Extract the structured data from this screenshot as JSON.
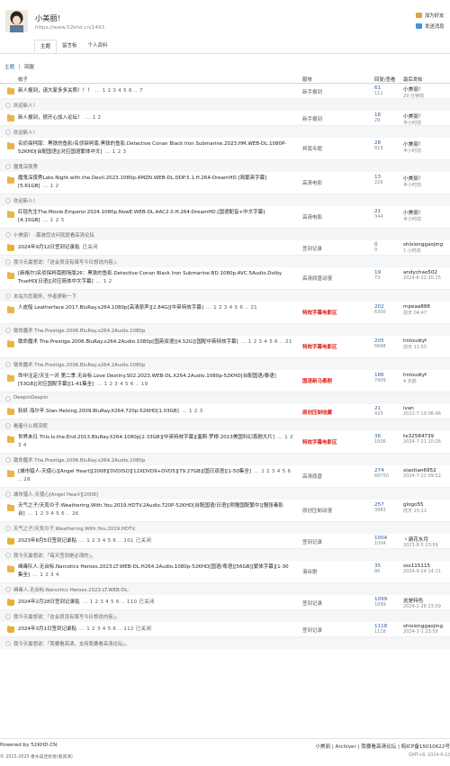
{
  "site": {
    "name": "小美丽！",
    "url": "https://www.52khd.cn/1493"
  },
  "header_actions": [
    {
      "label": "加为好友",
      "color": "#e0a23a"
    },
    {
      "label": "发送消息",
      "color": "#4a8fd6"
    }
  ],
  "tabs": [
    {
      "label": "主题",
      "active": true
    },
    {
      "label": "留言板",
      "active": false
    },
    {
      "label": "个人资料",
      "active": false
    }
  ],
  "breadcrumb": {
    "first": "主题",
    "second": "回复"
  },
  "table_header": {
    "title": "帖子",
    "forum": "版块",
    "replies": "回复/查看",
    "last": "最后发帖"
  },
  "rows": [
    {
      "title": "新人报到，请大家多多关照！！！",
      "pages": "... 1 2 3 4 5 6 .. 7",
      "forum": "新手报到",
      "forum_red": false,
      "replies": "61",
      "views": "111",
      "last_user": "小美丽！",
      "last_time": "29 分钟前",
      "sub": "欢迎新人！",
      "lines": 1,
      "icon": "folder"
    },
    {
      "title": "新人报到，很开心加入论坛！",
      "pages": "... 1 2",
      "forum": "新手报到",
      "forum_red": false,
      "replies": "18",
      "views": "29",
      "last_user": "小美丽！",
      "last_time": "半小时前",
      "sub": "欢迎新人！",
      "lines": 1,
      "icon": "folder"
    },
    {
      "title": "名侦探柯南：黑铁的鱼影/名侦探柯南.黑铁的鱼影.Detective Conan Black Iron Submarine.2023.HM.WEB-DL.1080P-52KHD[台配国语][对应国语繁体中文]",
      "pages": "... 1 2 3",
      "forum": "柯南专题",
      "forum_red": false,
      "replies": "28",
      "views": "819",
      "last_user": "小美丽！",
      "last_time": "半小时前",
      "sub": "魔鬼深夜秀",
      "lines": 2,
      "icon": "folder"
    },
    {
      "title": "魔鬼深夜秀Late.Night.with.the.Devil.2023.1080p.AMZN.WEB-DL.DDP.5.1.H.264-DreamHD.[简繁英字幕][5.61GB]",
      "pages": "... 1 2",
      "forum": "高清电影",
      "forum_red": false,
      "replies": "13",
      "views": "226",
      "last_user": "小美丽！",
      "last_time": "半小时前",
      "sub": "欢迎新人！",
      "lines": 2,
      "icon": "folder"
    },
    {
      "title": "红毯先生The.Movie.Emperor.2024.1080p.NowE.WEB-DL.AAC2.0.H.264-DreamHD.[国语配音+中文字幕][4.15GB]",
      "pages": "... 1 2 3",
      "forum": "高清电影",
      "forum_red": false,
      "replies": "21",
      "views": "344",
      "last_user": "小美丽！",
      "last_time": "半小时前",
      "sub": "小美丽！  :慕游您访问就提看高清论坛",
      "lines": 2,
      "icon": "folder"
    },
    {
      "title": "2024年9月12日签到记录贴",
      "pages": "已关闭",
      "forum": "签到记录",
      "forum_red": false,
      "replies": "0",
      "views": "0",
      "last_user": "shixionggaojing",
      "last_time": "1 小时前",
      "sub": "我今天最想说：「这会员没有填写今日想说内容」。",
      "lines": 1,
      "icon": "lock"
    },
    {
      "title": "[新格尔]名侦探柯南剧场版26：黑铁的鱼影.Detective Conan Black Iron Submarine.BD.1080p.AVC.5Audio.Dolby TrueHD[日语][对应简体中文字幕]",
      "pages": "... 1 2",
      "forum": "高清原盘动漫",
      "forum_red": false,
      "replies": "19",
      "views": "73",
      "last_user": "andychao502",
      "last_time": "2024-8-22 20:25",
      "sub": "本站为您服务，作者更新一下",
      "lines": 2,
      "icon": "folder"
    },
    {
      "title": "人皮船 Leatherface.2017.BluRay.x264.1080p[高清原声][2.84G][中英特效字幕]",
      "pages": "... 1 2 3 4 5 6 .. 21",
      "forum": "特效字幕电影区",
      "forum_red": true,
      "replies": "202",
      "views": "6300",
      "last_user": "mpeaa888",
      "last_time": "前天 04:47",
      "sub": "致命魔术 The.Prestige.2006.BluRay.x264.2Audio.1080p",
      "lines": 2,
      "icon": "folder"
    },
    {
      "title": "致命魔术 The.Prestige.2006.BluRay.x264.2Audio.1080p[国英双语][4.52G][国配中英特效字幕]",
      "pages": "... 1 2 3 4 5 6 .. 21",
      "forum": "特效字幕电影区",
      "forum_red": true,
      "replies": "205",
      "views": "6848",
      "last_user": "hnloudiyf",
      "last_time": "前天 11:55",
      "sub": "致命魔术 The.Prestige.2006.BluRay.x264.2Audio.1080p",
      "lines": 2,
      "icon": "folder"
    },
    {
      "title": "命中注定/天生一对 第二季.无台标.Love Destiny.S02.2023.WEB-DL.X264.2Audio.1080p-52KHD[台配国语/泰语][53GB][对应国配字幕][1-41集全]",
      "pages": "... 1 2 3 4 5 6 .. 19",
      "forum": "国语新马泰剧",
      "forum_red": true,
      "replies": "186",
      "views": "7409",
      "last_user": "hnloudiyf",
      "last_time": "4 天前",
      "sub": "DeepinDeepin",
      "lines": 2,
      "icon": "folder"
    },
    {
      "title": "斩妖 海尔辛.Stan.Helsing.2009.BluRay.X264.720p-52KHD[1.03GB]",
      "pages": "... 1 2 3",
      "forum": "原创压制收藏",
      "forum_red": true,
      "replies": "21",
      "views": "425",
      "last_user": "ivan",
      "last_time": "2022-7-19 06:46",
      "sub": "看着什么情况呢",
      "lines": 1,
      "icon": "folder"
    },
    {
      "title": "世界末日.This.Is.the.End.2013.BluRay.X264.1080p[2.33GB][中英特效字幕][塞斯·罗根·2013美国科幻喜剧大片]",
      "pages": "... 1 2 3 4",
      "forum": "特效字幕电影区",
      "forum_red": true,
      "replies": "36",
      "views": "1936",
      "last_user": "te32584739",
      "last_time": "2024-7-11 10:26",
      "sub": "致命魔术 The.Prestige.2006.BluRay.x264.2Audio.1080p",
      "lines": 2,
      "icon": "folder"
    },
    {
      "title": "[城市猎人-天使心][Angel Heart][2008][DVDISO][12XDVD9+DVD5][79.27GB][国日双语][1-50集全]",
      "pages": "... 1 2 3 4 5 6 .. 28",
      "forum": "高清原盘",
      "forum_red": false,
      "replies": "274",
      "views": "68750",
      "last_user": "xiaotian6952",
      "last_time": "2024-7-22 09:52",
      "sub": "城市猎人-天使心[Angel Heart][2008]",
      "lines": 2,
      "icon": "folder"
    },
    {
      "title": "天气之子/天気の子.Weathering.With.You.2019.HDTV.2Audio.720P-52KHD[台配国语/日语][附赠国配繁中][赠张毒影台]",
      "pages": "... 1 2 3 4 5 6 .. 26",
      "forum": "原创压制动漫",
      "forum_red": false,
      "replies": "257",
      "views": "3983",
      "last_user": "glogo55",
      "last_time": "前天 15:11",
      "sub": "天气之子/天気の子.Weathering.With.You.2019.HDTV.",
      "lines": 2,
      "icon": "folder"
    },
    {
      "title": "2023年8月5日签到记录贴",
      "pages": "... 1 2 3 4 5 6 .. 101 已关闭",
      "forum": "签到记录",
      "forum_red": false,
      "replies": "1004",
      "views": "1004",
      "last_user": "ヽ骑花水月",
      "last_time": "2023-8-5 23:59",
      "sub": "我今天最想说：「每天签到是必须的」。",
      "lines": 1,
      "icon": "lock"
    },
    {
      "title": "缉毒队人.无台标.Narcotics Heroes.2023.LT.WEB-DL.H264.2Audio.1080p-52KHD[国语/粤语][56GB][繁体字幕][1-30集全]",
      "pages": "... 1 2 3 4",
      "forum": "港台剧",
      "forum_red": false,
      "replies": "35",
      "views": "86",
      "last_user": "sss115115",
      "last_time": "2024-9-24 14:11",
      "sub": "缉毒人.无台标.Narcotics Heroes.2023.LT.WEB-DL.",
      "lines": 2,
      "icon": "folder"
    },
    {
      "title": "2024年2月28日签到记录贴",
      "pages": "... 1 2 3 4 5 6 .. 110 已关闭",
      "forum": "签到记录",
      "forum_red": false,
      "replies": "1099",
      "views": "1099",
      "last_user": "这是特色",
      "last_time": "2024-2-28 23:59",
      "sub": "我今天最想说：「这会员没有填写今日想说内容」。",
      "lines": 1,
      "icon": "lock"
    },
    {
      "title": "2024年3月1日签到记录贴",
      "pages": "... 1 2 3 4 5 6 .. 112 已关闭",
      "forum": "签到记录",
      "forum_red": false,
      "replies": "1118",
      "views": "1118",
      "last_user": "shixionggaojing",
      "last_time": "2024-3-1 23:59",
      "sub": "我今天最想说：「我要看高清，支持我要看高清论坛」。",
      "lines": 1,
      "icon": "lock"
    }
  ],
  "footer": {
    "powered": "Powered by 52KHD.CN",
    "copyright": "© 2015-2025 香木成佳修善(看高清)",
    "links": "小美丽 | Archiver | 我要看高清论坛 | 皖ICP备15010622号",
    "time": "GMT+8, 2024-9-12"
  }
}
